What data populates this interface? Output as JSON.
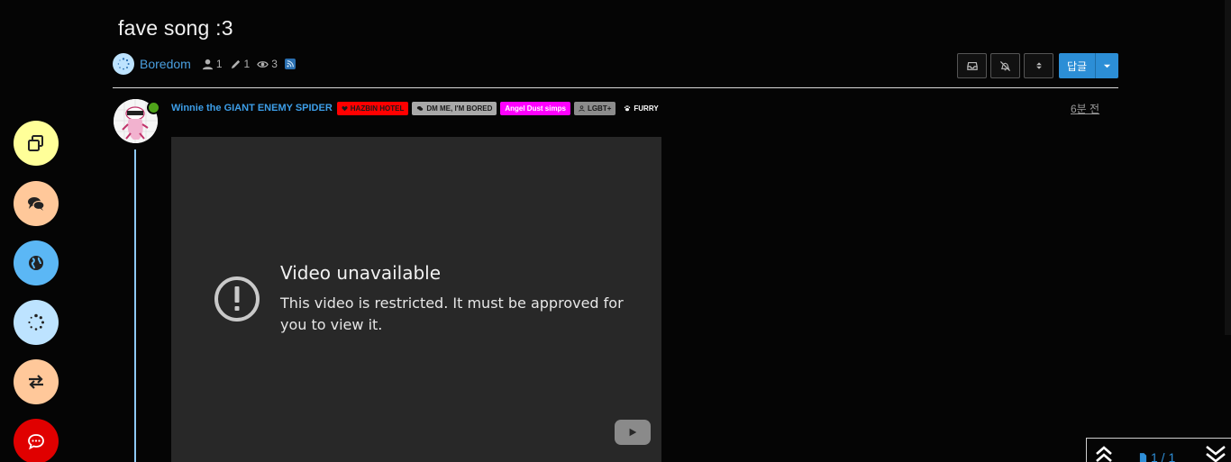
{
  "topic": {
    "title": "fave song :3",
    "category": "Boredom",
    "posters_count": "1",
    "posts_count": "1",
    "views_count": "3",
    "reply_label": "답글"
  },
  "post": {
    "author": "Winnie the GIANT ENEMY SPIDER",
    "time_ago": "6분 전",
    "badges": [
      {
        "label": "HAZBIN HOTEL",
        "bg": "#ff0000",
        "fg": "#1a1a1a",
        "icon": "heart-icon"
      },
      {
        "label": "DM ME, I'M BORED",
        "bg": "#a9a9a9",
        "fg": "#1a1a1a",
        "icon": "chat-icon"
      },
      {
        "label": "Angel Dust simps",
        "bg": "#ff00ff",
        "fg": "#ffffff",
        "icon": ""
      },
      {
        "label": "LGBT+",
        "bg": "#8c8c8c",
        "fg": "#1a1a1a",
        "icon": "user-icon"
      },
      {
        "label": "FURRY",
        "bg": "transparent",
        "fg": "#ffffff",
        "icon": "paw-icon"
      }
    ]
  },
  "video": {
    "title": "Video unavailable",
    "message": "This video is restricted. It must be approved for you to view it."
  },
  "pagination": {
    "label": "1 / 1"
  },
  "side_buttons": [
    {
      "name": "copy",
      "color": "#ffff99"
    },
    {
      "name": "chats",
      "color": "#ffc89a"
    },
    {
      "name": "globe",
      "color": "#5bb7f5"
    },
    {
      "name": "loading",
      "color": "#bde3ff"
    },
    {
      "name": "swap",
      "color": "#ffc89a"
    },
    {
      "name": "chat-bubble",
      "color": "#e00000"
    }
  ]
}
